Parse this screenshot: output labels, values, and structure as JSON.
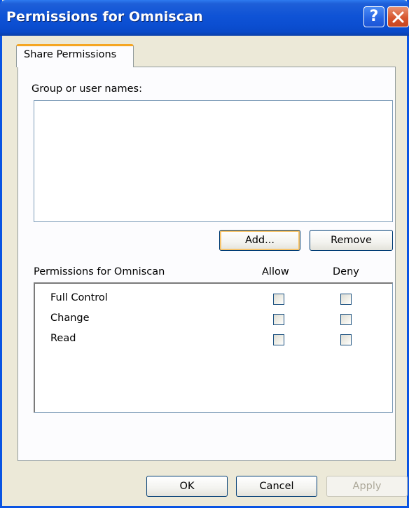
{
  "window": {
    "title": "Permissions for Omniscan",
    "help_button": "?",
    "close_icon": "close-icon"
  },
  "tabs": [
    {
      "label": "Share Permissions",
      "selected": true
    }
  ],
  "group_section": {
    "label": "Group or user names:",
    "items": []
  },
  "buttons": {
    "add": "Add...",
    "remove": "Remove",
    "ok": "OK",
    "cancel": "Cancel",
    "apply": "Apply"
  },
  "permissions": {
    "header": "Permissions for Omniscan",
    "allow_header": "Allow",
    "deny_header": "Deny",
    "rows": [
      {
        "label": "Full Control",
        "allow": false,
        "deny": false
      },
      {
        "label": "Change",
        "allow": false,
        "deny": false
      },
      {
        "label": "Read",
        "allow": false,
        "deny": false
      }
    ]
  },
  "colors": {
    "titlebar": "#0a54e3",
    "dialog_bg": "#ece9d8",
    "tab_accent": "#f5a623",
    "close_button": "#d7562e"
  }
}
